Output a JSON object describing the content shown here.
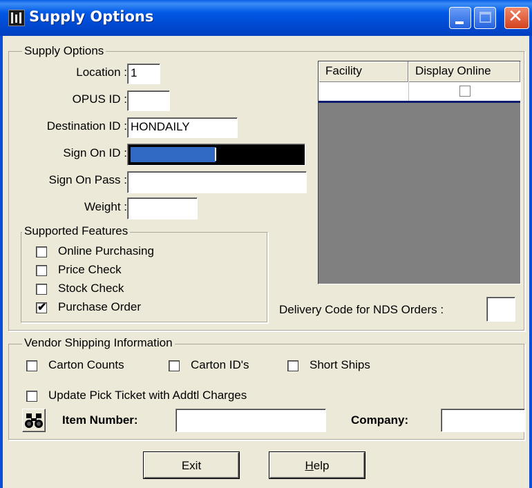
{
  "window": {
    "title": "Supply Options"
  },
  "supply_group": {
    "legend": "Supply Options",
    "location_label": "Location :",
    "location_value": "1",
    "opus_label": "OPUS ID :",
    "opus_value": "",
    "destination_label": "Destination ID :",
    "destination_value": "HONDAILY",
    "signon_id_label": "Sign On ID :",
    "signon_pass_label": "Sign On Pass :",
    "signon_pass_value": "",
    "weight_label": "Weight :",
    "weight_value": ""
  },
  "features": {
    "legend": "Supported Features",
    "items": [
      {
        "label": "Online Purchasing",
        "checked": false
      },
      {
        "label": "Price Check",
        "checked": false
      },
      {
        "label": "Stock Check",
        "checked": false
      },
      {
        "label": "Purchase Order",
        "checked": true
      }
    ]
  },
  "facility_grid": {
    "columns": [
      "Facility",
      "Display Online"
    ],
    "rows": [
      {
        "facility": "",
        "display_online": false
      }
    ]
  },
  "delivery": {
    "label": "Delivery Code for NDS Orders :",
    "value": ""
  },
  "vendor_shipping": {
    "legend": "Vendor Shipping Information",
    "carton_counts": "Carton Counts",
    "carton_ids": "Carton ID's",
    "short_ships": "Short Ships",
    "update_pick": "Update Pick Ticket with Addtl Charges"
  },
  "item_search": {
    "item_label": "Item Number:",
    "item_value": "",
    "company_label": "Company:",
    "company_value": ""
  },
  "buttons": {
    "exit": "Exit",
    "help_prefix": "H",
    "help_rest": "elp"
  },
  "colors": {
    "title_bar": "#0054e3",
    "sign_on_fill": "#316ac5",
    "grid_empty": "#808080"
  }
}
